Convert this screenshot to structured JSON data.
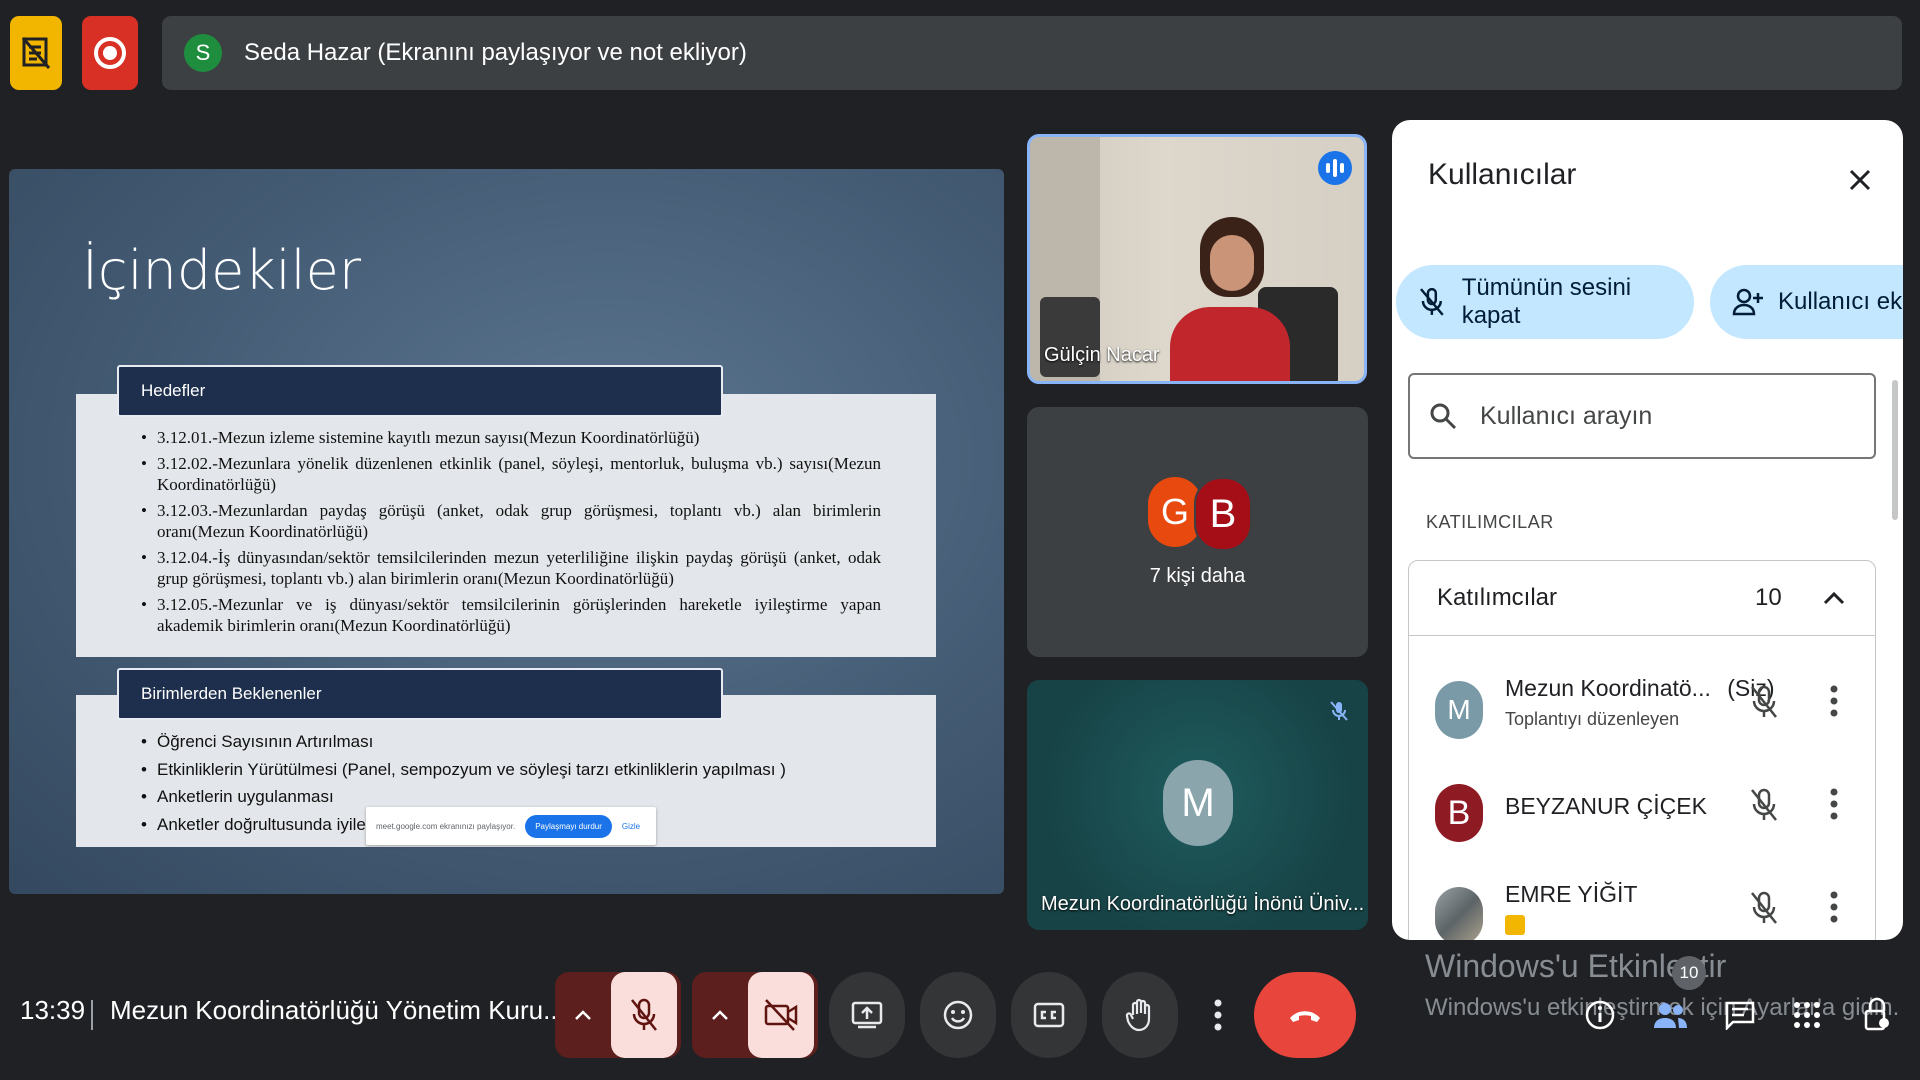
{
  "topbar": {
    "presenter_initial": "S",
    "presenter_text": "Seda Hazar (Ekranını paylaşıyor ve not ekliyor)"
  },
  "slide": {
    "title": "İçindekiler",
    "section1_title": "Hedefler",
    "section1_items": [
      "3.12.01.-Mezun izleme sistemine kayıtlı mezun sayısı(Mezun Koordinatörlüğü)",
      "3.12.02.-Mezunlara yönelik düzenlenen etkinlik (panel, söyleşi, mentorluk, buluşma vb.) sayısı(Mezun Koordinatörlüğü)",
      "3.12.03.-Mezunlardan paydaş görüşü (anket, odak grup görüşmesi, toplantı vb.) alan birimlerin oranı(Mezun Koordinatörlüğü)",
      "3.12.04.-İş dünyasından/sektör temsilcilerinden mezun yeterliliğine ilişkin paydaş görüşü (anket, odak grup görüşmesi, toplantı vb.) alan birimlerin oranı(Mezun Koordinatörlüğü)",
      "3.12.05.-Mezunlar ve iş dünyası/sektör temsilcilerinin görüşlerinden hareketle iyileştirme yapan akademik birimlerin oranı(Mezun Koordinatörlüğü)"
    ],
    "section2_title": "Birimlerden Beklenenler",
    "section2_items": [
      "Öğrenci Sayısının Artırılması",
      "Etkinliklerin Yürütülmesi (Panel, sempozyum ve söyleşi tarzı etkinliklerin yapılması )",
      "Anketlerin uygulanması",
      "Anketler doğrultusunda iyileş"
    ],
    "share_popup_text": "meet.google.com ekranınızı paylaşıyor.",
    "share_popup_button": "Paylaşmayı durdur",
    "share_popup_hide": "Gizle"
  },
  "tiles": {
    "speaker_name": "Gülçin Nacar",
    "more_initials": [
      "G",
      "B"
    ],
    "more_label": "7 kişi daha",
    "m_initial": "M",
    "m_name": "Mezun Koordinatörlüğü İnönü Üniv..."
  },
  "panel": {
    "title": "Kullanıcılar",
    "mute_all": "Tümünün sesini kapat",
    "add_user": "Kullanıcı ekle",
    "search_placeholder": "Kullanıcı arayın",
    "section_label": "KATILIMCILAR",
    "group_label": "Katılımcılar",
    "group_count": "10",
    "participants": [
      {
        "initial": "M",
        "name": "Mezun Koordinatö...",
        "tag": "(Siz)",
        "sub": "Toplantıyı düzenleyen",
        "color": "#7a9aa8"
      },
      {
        "initial": "B",
        "name": "BEYZANUR ÇİÇEK",
        "tag": "",
        "sub": "",
        "color": "#8e1a24"
      },
      {
        "initial": "",
        "name": "EMRE YİĞİT",
        "tag": "",
        "sub": "",
        "color": "#6d6f70"
      }
    ]
  },
  "bottombar": {
    "time": "13:39",
    "meeting_title": "Mezun Koordinatörlüğü Yönetim Kuru...",
    "people_count": "10",
    "watermark_title": "Windows'u Etkinleştir",
    "watermark_sub": "Windows'u etkinleştirmek için Ayarlar'a gidin."
  },
  "colors": {
    "background": "#202124",
    "accent_blue": "#1a73e8",
    "end_call_red": "#e8453c",
    "pill_blue": "#c2e7ff"
  }
}
